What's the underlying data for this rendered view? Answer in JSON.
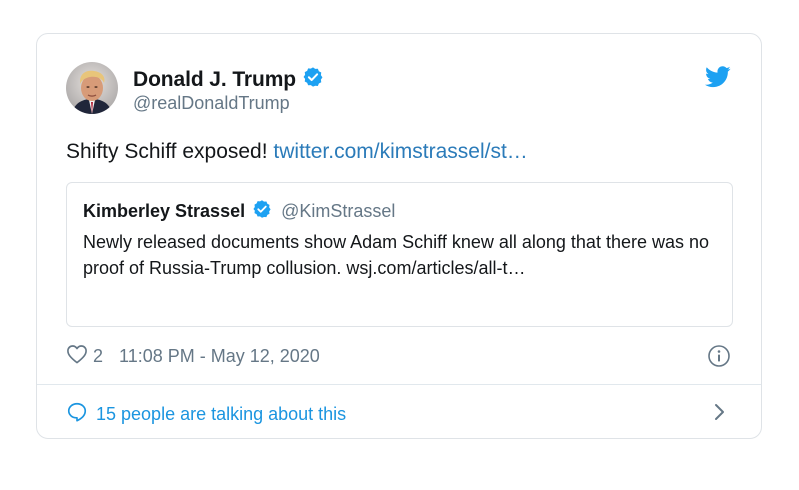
{
  "tweet": {
    "author_name": "Donald J. Trump",
    "author_handle": "@realDonaldTrump",
    "verified": true,
    "text": "Shifty Schiff exposed! ",
    "link_text": "twitter.com/kimstrassel/st…",
    "quote": {
      "author_name": "Kimberley Strassel",
      "author_handle": "@KimStrassel",
      "verified": true,
      "text": "Newly released documents show Adam Schiff knew all along that there was no proof of Russia-Trump collusion. wsj.com/articles/all-t…"
    },
    "like_count": "2",
    "timestamp": "11:08 PM - May 12, 2020",
    "talking_text": "15 people are talking about this"
  },
  "icons": {
    "verified": "verified-badge-icon",
    "brand": "twitter-bird-icon",
    "like": "heart-icon",
    "info": "info-icon",
    "talk": "speech-bubble-icon",
    "chevron": "chevron-right-icon"
  },
  "colors": {
    "link": "#2b7bb9",
    "brand_blue": "#1da1f2",
    "secondary_text": "#657786",
    "talk_link": "#1b95e0",
    "border": "#dfe3e7"
  }
}
